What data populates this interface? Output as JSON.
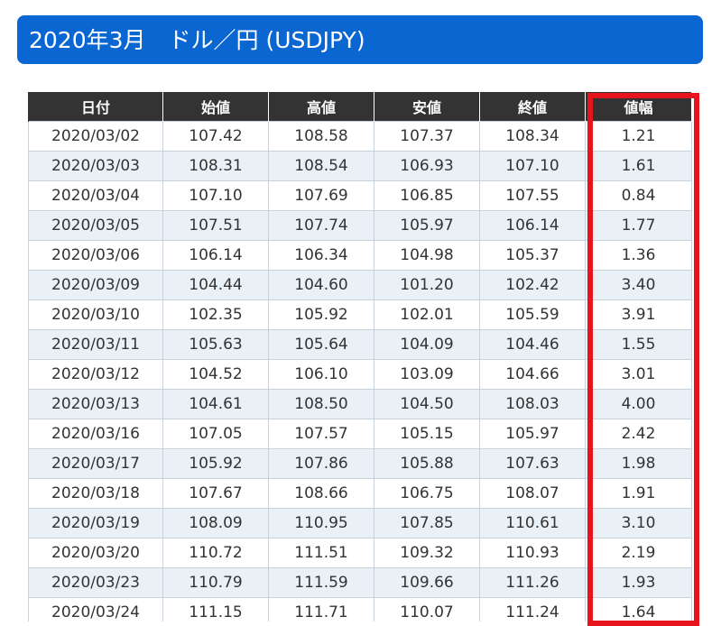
{
  "title": "2020年3月　ドル／円 (USDJPY)",
  "colors": {
    "title_bg": "#0a66d1",
    "header_bg": "#333333",
    "row_alt": "#e9f0f6",
    "highlight": "#e8141c"
  },
  "table": {
    "headers": [
      "日付",
      "始値",
      "高値",
      "安値",
      "終値",
      "値幅"
    ],
    "rows": [
      [
        "2020/03/02",
        "107.42",
        "108.58",
        "107.37",
        "108.34",
        "1.21"
      ],
      [
        "2020/03/03",
        "108.31",
        "108.54",
        "106.93",
        "107.10",
        "1.61"
      ],
      [
        "2020/03/04",
        "107.10",
        "107.69",
        "106.85",
        "107.55",
        "0.84"
      ],
      [
        "2020/03/05",
        "107.51",
        "107.74",
        "105.97",
        "106.14",
        "1.77"
      ],
      [
        "2020/03/06",
        "106.14",
        "106.34",
        "104.98",
        "105.37",
        "1.36"
      ],
      [
        "2020/03/09",
        "104.44",
        "104.60",
        "101.20",
        "102.42",
        "3.40"
      ],
      [
        "2020/03/10",
        "102.35",
        "105.92",
        "102.01",
        "105.59",
        "3.91"
      ],
      [
        "2020/03/11",
        "105.63",
        "105.64",
        "104.09",
        "104.46",
        "1.55"
      ],
      [
        "2020/03/12",
        "104.52",
        "106.10",
        "103.09",
        "104.66",
        "3.01"
      ],
      [
        "2020/03/13",
        "104.61",
        "108.50",
        "104.50",
        "108.03",
        "4.00"
      ],
      [
        "2020/03/16",
        "107.05",
        "107.57",
        "105.15",
        "105.97",
        "2.42"
      ],
      [
        "2020/03/17",
        "105.92",
        "107.86",
        "105.88",
        "107.63",
        "1.98"
      ],
      [
        "2020/03/18",
        "107.67",
        "108.66",
        "106.75",
        "108.07",
        "1.91"
      ],
      [
        "2020/03/19",
        "108.09",
        "110.95",
        "107.85",
        "110.61",
        "3.10"
      ],
      [
        "2020/03/20",
        "110.72",
        "111.51",
        "109.32",
        "110.93",
        "2.19"
      ],
      [
        "2020/03/23",
        "110.79",
        "111.59",
        "109.66",
        "111.26",
        "1.93"
      ],
      [
        "2020/03/24",
        "111.15",
        "111.71",
        "110.07",
        "111.24",
        "1.64"
      ]
    ]
  }
}
